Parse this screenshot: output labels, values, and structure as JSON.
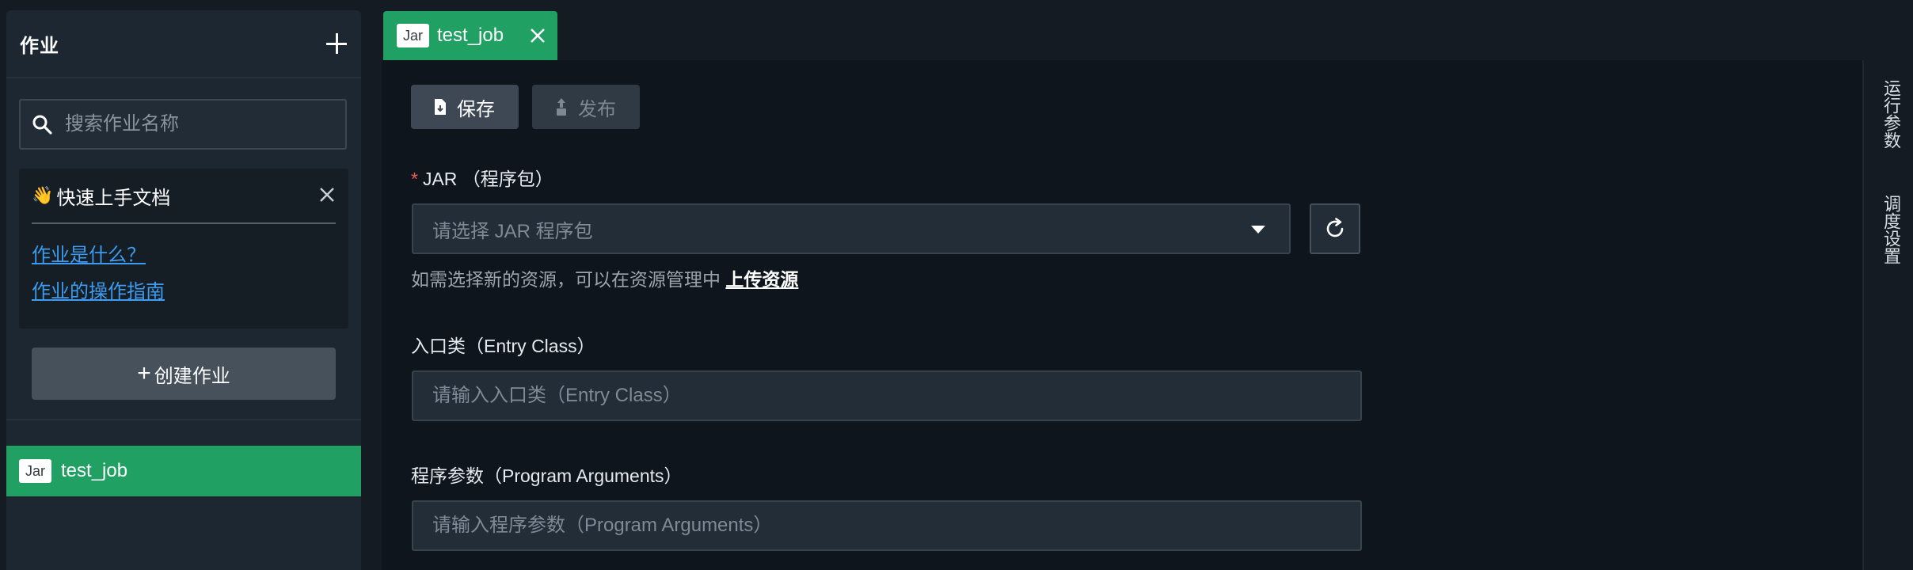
{
  "sidebar": {
    "title": "作业",
    "search_placeholder": "搜索作业名称",
    "doc_card": {
      "emoji": "👋",
      "title": "快速上手文档",
      "links": [
        "作业是什么？",
        "作业的操作指南"
      ]
    },
    "create_label": "创建作业",
    "jobs": [
      {
        "badge": "Jar",
        "name": "test_job",
        "selected": true
      }
    ]
  },
  "tab": {
    "badge": "Jar",
    "name": "test_job"
  },
  "toolbar": {
    "save_label": "保存",
    "publish_label": "发布"
  },
  "form": {
    "jar": {
      "required_mark": "*",
      "label": "JAR （程序包）",
      "placeholder": "请选择 JAR 程序包",
      "helper_text": "如需选择新的资源，可以在资源管理中",
      "helper_link": "上传资源"
    },
    "entry_class": {
      "label": "入口类（Entry Class）",
      "placeholder": "请输入入口类（Entry Class）",
      "value": ""
    },
    "program_args": {
      "label": "程序参数（Program Arguments）",
      "placeholder": "请输入程序参数（Program Arguments）",
      "value": ""
    }
  },
  "right_rail": {
    "tabs": [
      "运行参数",
      "调度设置"
    ]
  },
  "colors": {
    "accent_green": "#21a063",
    "link_blue": "#3d9cf0",
    "required_red": "#f05a5a"
  }
}
